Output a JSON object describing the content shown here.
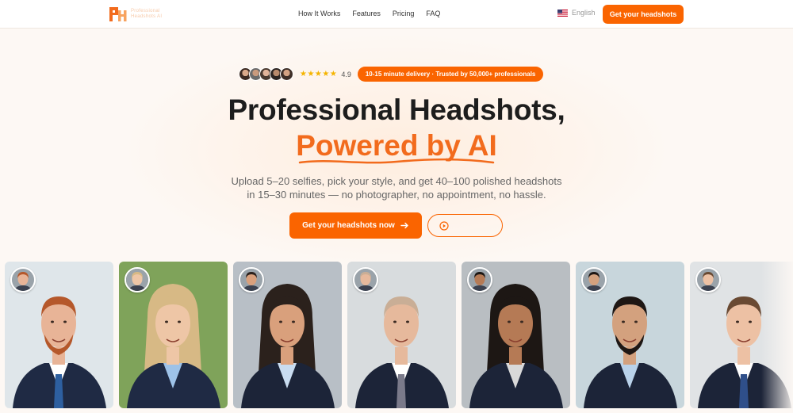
{
  "header": {
    "logo_text_line1": "Professional",
    "logo_text_line2": "Headshots AI",
    "nav": [
      "How It Works",
      "Features",
      "Pricing",
      "FAQ"
    ],
    "language": "English",
    "cta_label": "Get your headshots"
  },
  "hero": {
    "rating": "4.9",
    "stars": "★★★★★",
    "badge": "10-15 minute delivery · Trusted by 50,000+ professionals",
    "title_line1": "Professional Headshots,",
    "title_line2": "Powered by AI",
    "subtitle": "Upload 5–20 selfies, pick your style, and get 40–100 polished headshots in 15–30 minutes — no photographer, no appointment, no hassle.",
    "cta_primary": "Get your headshots now",
    "cta_secondary_icon": "play-circle-icon"
  },
  "colors": {
    "accent": "#fa6400",
    "headline": "#1d1d1d",
    "accent_text": "#f26b1d",
    "background": "#fdf8f4"
  },
  "gallery": {
    "cards": [
      {
        "name": "red-beard-man",
        "skin": "#e8b497",
        "hair": "#b5582b",
        "suit": "#1f2a44",
        "shirt": "#ffffff",
        "tie": "#2d5fa0",
        "bg": "#dfe6ea",
        "beard": true
      },
      {
        "name": "blonde-woman",
        "skin": "#eec6a6",
        "hair": "#d7b985",
        "suit": "#1f2a44",
        "shirt": "#9ec2e8",
        "tie": "",
        "bg": "#7fa35a",
        "beard": false
      },
      {
        "name": "glasses-woman",
        "skin": "#d9a07c",
        "hair": "#2b211c",
        "suit": "#1c2438",
        "shirt": "#c9dcf0",
        "tie": "",
        "bg": "#b8bfc6",
        "beard": false
      },
      {
        "name": "bald-man",
        "skin": "#e6b99c",
        "hair": "#c9ae96",
        "suit": "#1c2438",
        "shirt": "#ffffff",
        "tie": "#7a7a8a",
        "bg": "#d8dcde",
        "beard": false
      },
      {
        "name": "curly-woman",
        "skin": "#b57a55",
        "hair": "#1d1714",
        "suit": "#1c2438",
        "shirt": "#d9d9d9",
        "tie": "",
        "bg": "#b9bec2",
        "beard": false
      },
      {
        "name": "dark-beard-man",
        "skin": "#d3a17e",
        "hair": "#1e1714",
        "suit": "#1c2438",
        "shirt": "#b9d2ea",
        "tie": "",
        "bg": "#c8d6dc",
        "beard": true
      },
      {
        "name": "young-man",
        "skin": "#edc1a4",
        "hair": "#6a4a33",
        "suit": "#1c2438",
        "shirt": "#ffffff",
        "tie": "#2f4f8a",
        "bg": "#e0e3e5",
        "beard": false
      }
    ]
  }
}
